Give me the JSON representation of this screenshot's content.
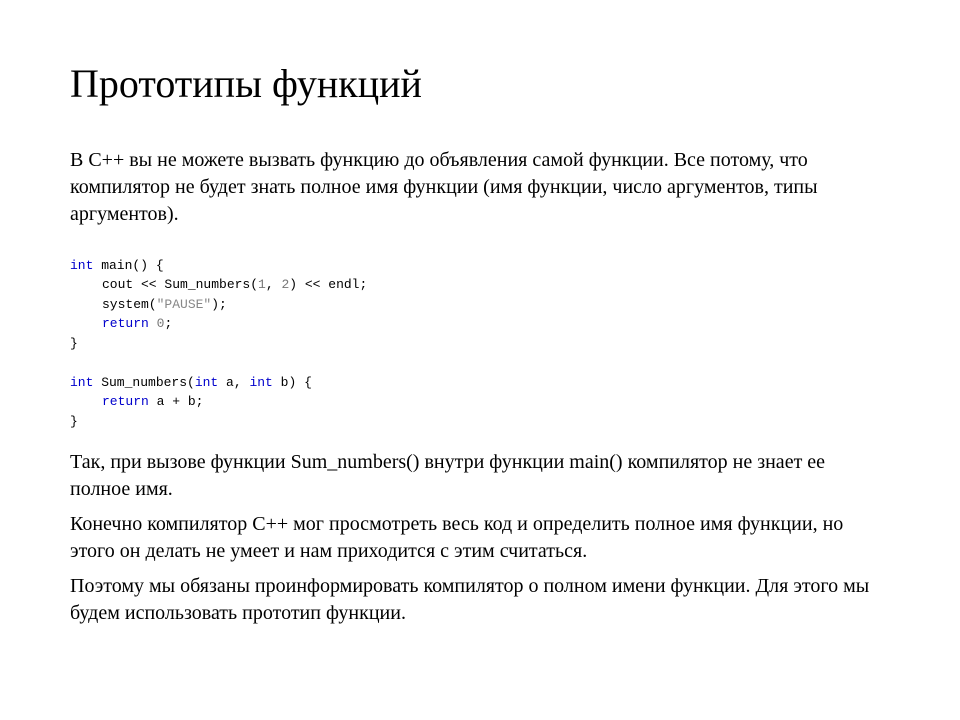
{
  "title": "Прототипы функций",
  "para1": "В C++ вы не можете вызвать функцию до объявления самой функции. Все потому, что компилятор не будет знать полное имя функции (имя функции, число аргументов, типы аргументов).",
  "code": {
    "l1_kw": "int",
    "l1_rest": " main() {",
    "l2_a": "cout << Sum_numbers(",
    "l2_n1": "1",
    "l2_b": ", ",
    "l2_n2": "2",
    "l2_c": ") << endl;",
    "l3_a": "system(",
    "l3_str": "\"PAUSE\"",
    "l3_b": ");",
    "l4_kw": "return",
    "l4_sp": " ",
    "l4_n": "0",
    "l4_b": ";",
    "l5": "}",
    "l6_kw1": "int",
    "l6_a": " Sum_numbers(",
    "l6_kw2": "int",
    "l6_b": " a, ",
    "l6_kw3": "int",
    "l6_c": " b) {",
    "l7_kw": "return",
    "l7_rest": " a + b;",
    "l8": "}"
  },
  "para2": "Так, при вызове функции Sum_numbers() внутри функции main() компилятор не знает ее полное имя.",
  "para3": "Конечно компилятор C++ мог просмотреть весь код и определить полное имя функции, но этого он делать не умеет и нам приходится с этим считаться.",
  "para4": "Поэтому мы обязаны проинформировать компилятор о полном имени функции. Для этого мы будем использовать прототип функции."
}
